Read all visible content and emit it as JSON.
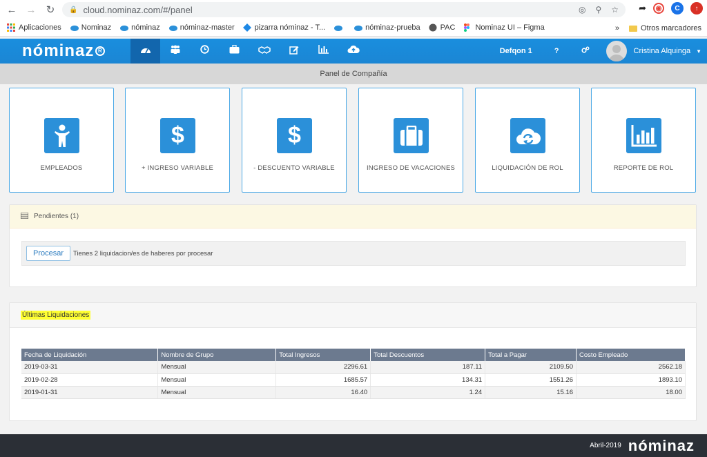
{
  "browser": {
    "url": "cloud.nominaz.com/#/panel",
    "bookmarks": [
      "Aplicaciones",
      "Nominaz",
      "nóminaz",
      "nóminaz-master",
      "pizarra nóminaz - T...",
      "nóminaz-prueba",
      "PAC",
      "Nominaz UI – Figma"
    ],
    "more": "»",
    "other_bookmarks": "Otros marcadores",
    "profile_initial": "C"
  },
  "header": {
    "logo": "nóminaz",
    "company": "Defqon 1",
    "help": "?",
    "user": "Cristina Alquinga"
  },
  "subbar": {
    "title": "Panel de Compañía"
  },
  "tiles": [
    {
      "label": "EMPLEADOS",
      "icon": "person-icon"
    },
    {
      "label": "+ INGRESO VARIABLE",
      "icon": "dollar-icon"
    },
    {
      "label": "- DESCUENTO VARIABLE",
      "icon": "dollar-icon"
    },
    {
      "label": "INGRESO DE VACACIONES",
      "icon": "briefcase-icon"
    },
    {
      "label": "LIQUIDACIÓN DE ROL",
      "icon": "cloud-sync-icon"
    },
    {
      "label": "REPORTE DE ROL",
      "icon": "bar-chart-icon"
    }
  ],
  "pending": {
    "title": "Pendientes (1)",
    "button": "Procesar",
    "message": "Tienes 2 liquidacion/es de haberes por procesar"
  },
  "latest": {
    "title": "Últimas Liquidaciones",
    "columns": [
      "Fecha de Liquidación",
      "Nombre de Grupo",
      "Total Ingresos",
      "Total Descuentos",
      "Total a Pagar",
      "Costo Empleado"
    ],
    "rows": [
      [
        "2019-03-31",
        "Mensual",
        "2296.61",
        "187.11",
        "2109.50",
        "2562.18"
      ],
      [
        "2019-02-28",
        "Mensual",
        "1685.57",
        "134.31",
        "1551.26",
        "1893.10"
      ],
      [
        "2019-01-31",
        "Mensual",
        "16.40",
        "1.24",
        "15.16",
        "18.00"
      ]
    ]
  },
  "footer": {
    "date": "Abril-2019",
    "logo": "nóminaz"
  },
  "colors": {
    "primary": "#1a8ede",
    "active": "#1266ad",
    "tile_icon": "#2b90d9",
    "footer": "#2b2f36",
    "highlight": "#ffff32"
  }
}
